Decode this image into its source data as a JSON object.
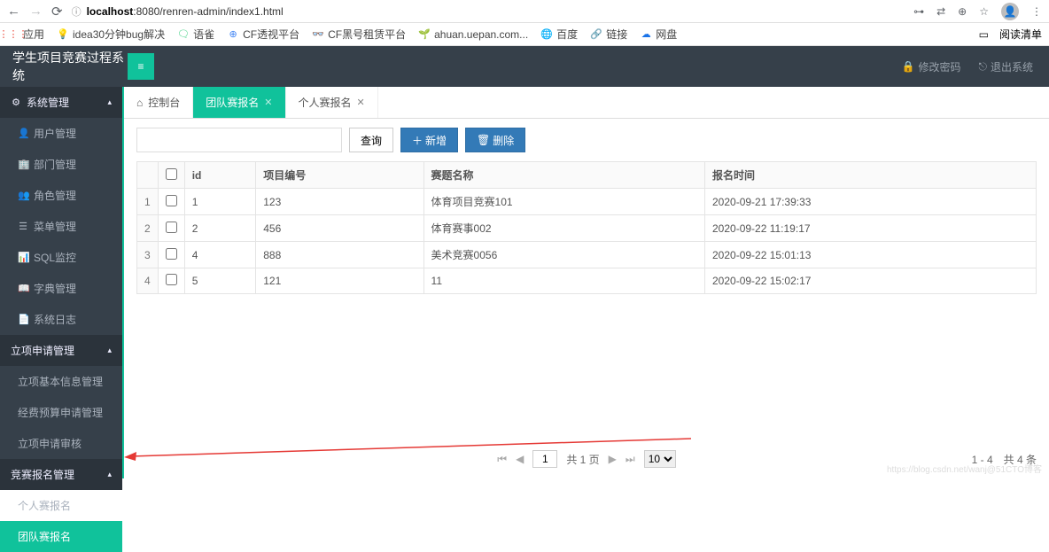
{
  "browser": {
    "url_host": "localhost",
    "url_path": ":8080/renren-admin/index1.html",
    "reading_list": "阅读清单"
  },
  "bookmarks": [
    {
      "icon": "grid",
      "label": "应用",
      "color": "#1a73e8"
    },
    {
      "icon": "bulb",
      "label": "idea30分钟bug解决",
      "color": "#f9ab00"
    },
    {
      "icon": "yq",
      "label": "语雀",
      "color": "#31cc79"
    },
    {
      "icon": "cf1",
      "label": "CF透视平台",
      "color": "#4285f4"
    },
    {
      "icon": "cf2",
      "label": "CF黑号租赁平台",
      "color": "#333"
    },
    {
      "icon": "ah",
      "label": "ahuan.uepan.com...",
      "color": "#2e7d32"
    },
    {
      "icon": "bd",
      "label": "百度",
      "color": "#333"
    },
    {
      "icon": "link",
      "label": "链接",
      "color": "#2e7d32"
    },
    {
      "icon": "wp",
      "label": "网盘",
      "color": "#1a73e8"
    }
  ],
  "header": {
    "brand": "学生项目竞赛过程系统",
    "change_pw": "修改密码",
    "logout": "退出系统"
  },
  "sidebar": {
    "groups": [
      {
        "label": "系统管理",
        "icon": "⚙",
        "items": [
          {
            "icon": "👤",
            "label": "用户管理"
          },
          {
            "icon": "🏢",
            "label": "部门管理"
          },
          {
            "icon": "👥",
            "label": "角色管理"
          },
          {
            "icon": "☰",
            "label": "菜单管理"
          },
          {
            "icon": "📊",
            "label": "SQL监控"
          },
          {
            "icon": "📖",
            "label": "字典管理"
          },
          {
            "icon": "📄",
            "label": "系统日志"
          }
        ]
      },
      {
        "label": "立项申请管理",
        "icon": "",
        "items": [
          {
            "icon": "",
            "label": "立项基本信息管理"
          },
          {
            "icon": "",
            "label": "经费预算申请管理"
          },
          {
            "icon": "",
            "label": "立项申请审核"
          }
        ]
      },
      {
        "label": "竞赛报名管理",
        "icon": "",
        "items": [
          {
            "icon": "",
            "label": "个人赛报名"
          },
          {
            "icon": "",
            "label": "团队赛报名",
            "active": true
          }
        ]
      }
    ]
  },
  "tabs": [
    {
      "label": "控制台",
      "home": true
    },
    {
      "label": "团队赛报名",
      "active": true,
      "closable": true
    },
    {
      "label": "个人赛报名",
      "closable": true
    }
  ],
  "toolbar": {
    "search_btn": "查询",
    "add_btn": "新增",
    "del_btn": "删除"
  },
  "table": {
    "columns": [
      "id",
      "项目编号",
      "赛题名称",
      "报名时间"
    ],
    "rows": [
      {
        "n": "1",
        "id": "1",
        "proj": "123",
        "title": "体育项目竞赛101",
        "time": "2020-09-21 17:39:33"
      },
      {
        "n": "2",
        "id": "2",
        "proj": "456",
        "title": "体育赛事002",
        "time": "2020-09-22 11:19:17"
      },
      {
        "n": "3",
        "id": "4",
        "proj": "888",
        "title": "美术竞赛0056",
        "time": "2020-09-22 15:01:13"
      },
      {
        "n": "4",
        "id": "5",
        "proj": "121",
        "title": "11",
        "time": "2020-09-22 15:02:17"
      }
    ]
  },
  "pager": {
    "page": "1",
    "total_pages": "共 1 页",
    "page_size": "10",
    "summary": "1 - 4　共 4 条"
  },
  "watermark": "https://blog.csdn.net/wanj@51CTO博客"
}
